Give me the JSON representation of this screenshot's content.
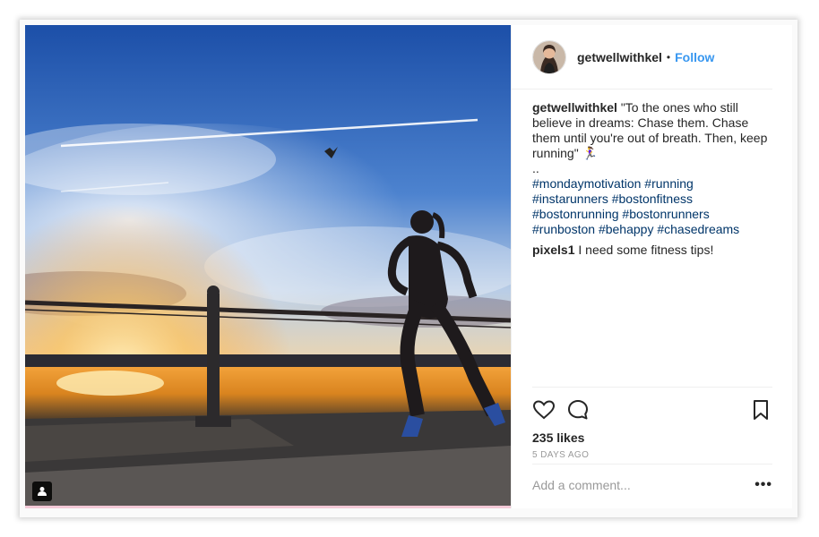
{
  "post": {
    "username": "getwellwithkel",
    "separator": "•",
    "follow_label": "Follow",
    "caption": {
      "username": "getwellwithkel",
      "text": "\"To the ones who still believe in dreams: Chase them. Chase them until you're out of breath. Then, keep running\" 🏃‍♀️",
      "dots": "..",
      "hashtag_lines": [
        [
          "#mondaymotivation",
          "#running"
        ],
        [
          "#instarunners",
          "#bostonfitness"
        ],
        [
          "#bostonrunning",
          "#bostonrunners"
        ],
        [
          "#runboston",
          "#behappy",
          "#chasedreams"
        ]
      ]
    },
    "comments": [
      {
        "username": "pixels1",
        "text": "I need some fitness tips!"
      }
    ],
    "likes": "235 likes",
    "timestamp": "5 DAYS AGO",
    "comment_placeholder": "Add a comment...",
    "more_label": "•••"
  },
  "icons": {
    "like": "heart-icon",
    "comment": "comment-bubble-icon",
    "save": "bookmark-icon",
    "tagged": "person-tag-icon"
  },
  "colors": {
    "link": "#3897f0",
    "hashtag": "#003569",
    "muted": "#999999",
    "text": "#262626"
  }
}
